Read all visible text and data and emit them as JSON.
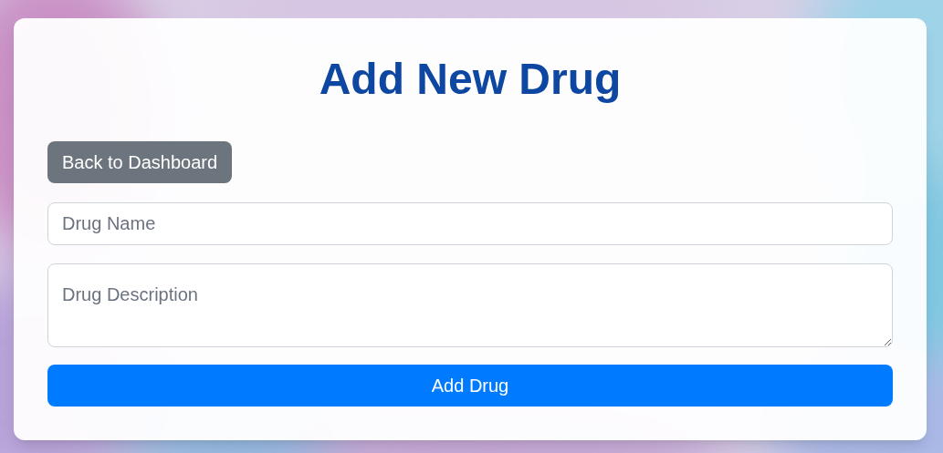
{
  "title": "Add New Drug",
  "back_button": {
    "label": "Back to Dashboard"
  },
  "fields": [
    {
      "kind": "input",
      "placeholder": "Drug Name"
    },
    {
      "kind": "textarea",
      "placeholder": "Drug Description"
    }
  ],
  "submit_button": {
    "label": "Add Drug"
  }
}
